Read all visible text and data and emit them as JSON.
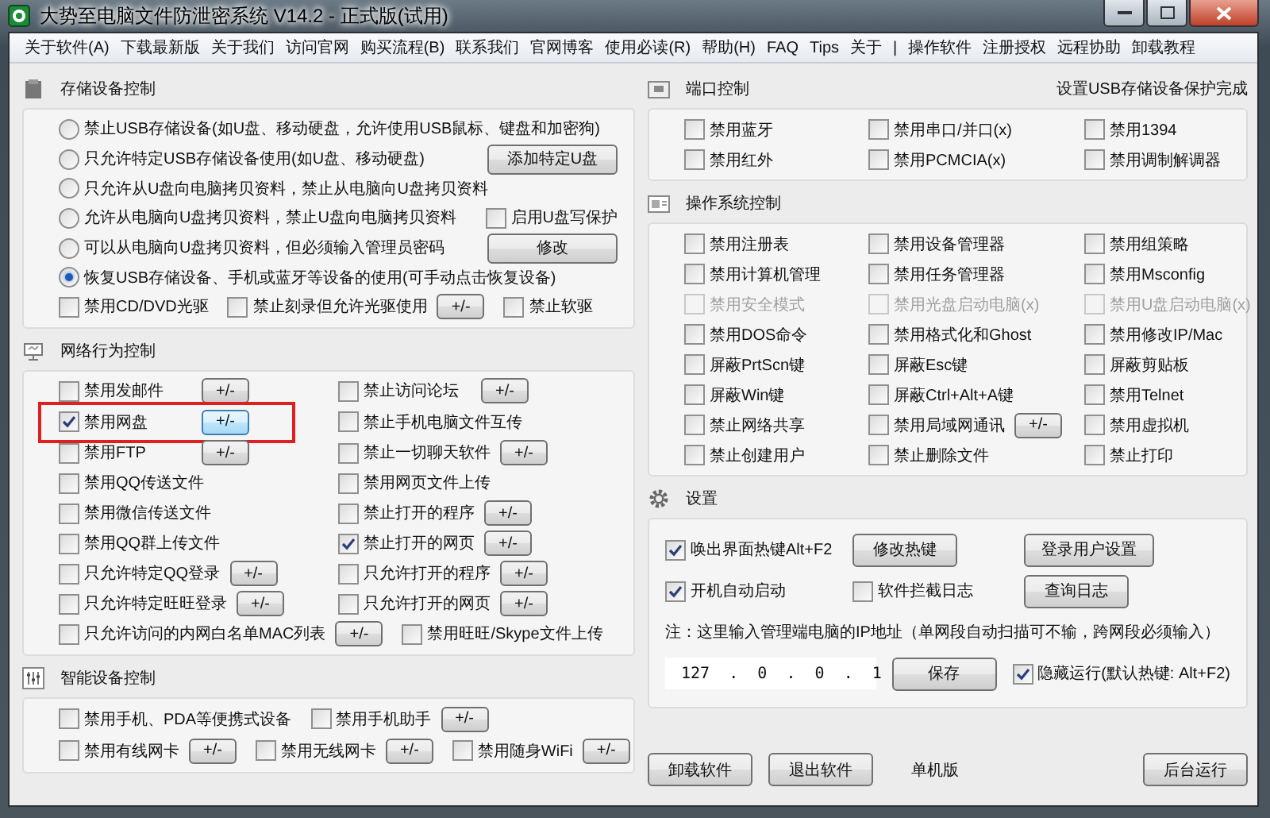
{
  "window": {
    "title": "大势至电脑文件防泄密系统 V14.2 - 正式版(试用)"
  },
  "menu": [
    {
      "label": "关于软件(A)"
    },
    {
      "label": "下载最新版"
    },
    {
      "label": "关于我们"
    },
    {
      "label": "访问官网"
    },
    {
      "label": "购买流程(B)"
    },
    {
      "label": "联系我们"
    },
    {
      "label": "官网博客"
    },
    {
      "label": "使用必读(R)"
    },
    {
      "label": "帮助(H)"
    },
    {
      "label": "FAQ"
    },
    {
      "label": "Tips"
    },
    {
      "label": "关于"
    },
    {
      "label": "|"
    },
    {
      "label": "操作软件"
    },
    {
      "label": "注册授权"
    },
    {
      "label": "远程协助"
    }
  ],
  "menu_right": {
    "label": "卸载教程"
  },
  "left_sections": [
    {
      "kind": "storage",
      "title": "存储设备控制",
      "rows": [
        {
          "kind": "line",
          "items": [
            {
              "kind": "radio",
              "label": "禁止USB存储设备(如U盘、移动硬盘，允许使用USB鼠标、键盘和加密狗)",
              "selected": false
            }
          ]
        },
        {
          "kind": "line",
          "items": [
            {
              "kind": "radio",
              "label": "只允许特定USB存储设备使用(如U盘、移动硬盘)",
              "selected": false
            },
            {
              "kind": "button",
              "label": "添加特定U盘"
            }
          ]
        },
        {
          "kind": "line",
          "items": [
            {
              "kind": "radio",
              "label": "只允许从U盘向电脑拷贝资料，禁止从电脑向U盘拷贝资料",
              "selected": false
            }
          ]
        },
        {
          "kind": "line",
          "items": [
            {
              "kind": "radio",
              "label": "允许从电脑向U盘拷贝资料，禁止U盘向电脑拷贝资料",
              "selected": false
            },
            {
              "kind": "checkbox",
              "label": "启用U盘写保护",
              "checked": false
            }
          ]
        },
        {
          "kind": "line",
          "items": [
            {
              "kind": "radio",
              "label": "可以从电脑向U盘拷贝资料，但必须输入管理员密码",
              "selected": false
            },
            {
              "kind": "button",
              "label": "修改"
            }
          ]
        },
        {
          "kind": "line",
          "items": [
            {
              "kind": "radio",
              "label": "恢复USB存储设备、手机或蓝牙等设备的使用(可手动点击恢复设备)",
              "selected": true
            }
          ]
        },
        {
          "kind": "flow",
          "items": [
            {
              "kind": "checkbox",
              "label": "禁用CD/DVD光驱",
              "checked": false
            },
            {
              "kind": "checkbox",
              "label": "禁止刻录但允许光驱使用",
              "checked": false,
              "button": "+/-"
            },
            {
              "kind": "checkbox",
              "label": "禁止软驱",
              "checked": false
            }
          ]
        }
      ]
    },
    {
      "kind": "network",
      "title": "网络行为控制",
      "rows": [
        {
          "kind": "grid",
          "items": [
            {
              "kind": "checkbox",
              "label": "禁用发邮件",
              "checked": false,
              "button": "+/-"
            },
            {
              "kind": "checkbox",
              "label": "禁止访问论坛",
              "checked": false,
              "button": "+/-"
            }
          ]
        },
        {
          "kind": "grid",
          "items": [
            {
              "kind": "checkbox",
              "label": "禁用网盘",
              "checked": true,
              "button": "+/-",
              "highlighted": true
            },
            {
              "kind": "checkbox",
              "label": "禁止手机电脑文件互传",
              "checked": false
            }
          ]
        },
        {
          "kind": "grid",
          "items": [
            {
              "kind": "checkbox",
              "label": "禁用FTP",
              "checked": false,
              "button": "+/-"
            },
            {
              "kind": "checkbox",
              "label": "禁止一切聊天软件",
              "checked": false,
              "button": "+/-"
            }
          ]
        },
        {
          "kind": "grid",
          "items": [
            {
              "kind": "checkbox",
              "label": "禁用QQ传送文件",
              "checked": false
            },
            {
              "kind": "checkbox",
              "label": "禁用网页文件上传",
              "checked": false
            }
          ]
        },
        {
          "kind": "grid",
          "items": [
            {
              "kind": "checkbox",
              "label": "禁用微信传送文件",
              "checked": false
            },
            {
              "kind": "checkbox",
              "label": "禁止打开的程序",
              "checked": false,
              "button": "+/-"
            }
          ]
        },
        {
          "kind": "grid",
          "items": [
            {
              "kind": "checkbox",
              "label": "禁用QQ群上传文件",
              "checked": false
            },
            {
              "kind": "checkbox",
              "label": "禁止打开的网页",
              "checked": true,
              "button": "+/-"
            }
          ]
        },
        {
          "kind": "grid",
          "items": [
            {
              "kind": "checkbox",
              "label": "只允许特定QQ登录",
              "checked": false,
              "button": "+/-"
            },
            {
              "kind": "checkbox",
              "label": "只允许打开的程序",
              "checked": false,
              "button": "+/-"
            }
          ]
        },
        {
          "kind": "grid",
          "items": [
            {
              "kind": "checkbox",
              "label": "只允许特定旺旺登录",
              "checked": false,
              "button": "+/-"
            },
            {
              "kind": "checkbox",
              "label": "只允许打开的网页",
              "checked": false,
              "button": "+/-"
            }
          ]
        },
        {
          "kind": "flow",
          "items": [
            {
              "kind": "checkbox",
              "label": "只允许访问的内网白名单MAC列表",
              "checked": false,
              "button": "+/-"
            },
            {
              "kind": "checkbox",
              "label": "禁用旺旺/Skype文件上传",
              "checked": false
            }
          ]
        }
      ]
    },
    {
      "kind": "smart",
      "title": "智能设备控制",
      "rows": [
        {
          "kind": "flow",
          "items": [
            {
              "kind": "checkbox",
              "label": "禁用手机、PDA等便携式设备",
              "checked": false
            },
            {
              "kind": "checkbox",
              "label": "禁用手机助手",
              "checked": false,
              "button": "+/-"
            }
          ]
        },
        {
          "kind": "flow",
          "items": [
            {
              "kind": "checkbox",
              "label": "禁用有线网卡",
              "checked": false,
              "button": "+/-"
            },
            {
              "kind": "checkbox",
              "label": "禁用无线网卡",
              "checked": false,
              "button": "+/-"
            },
            {
              "kind": "checkbox",
              "label": "禁用随身WiFi",
              "checked": false,
              "button": "+/-"
            }
          ]
        }
      ]
    }
  ],
  "right_sections": [
    {
      "kind": "port",
      "title": "端口控制",
      "status": "设置USB存储设备保护完成",
      "rows": [
        {
          "kind": "grid",
          "items": [
            {
              "kind": "checkbox",
              "label": "禁用蓝牙",
              "checked": false
            },
            {
              "kind": "checkbox",
              "label": "禁用串口/并口(x)",
              "checked": false
            },
            {
              "kind": "checkbox",
              "label": "禁用1394",
              "checked": false
            }
          ]
        },
        {
          "kind": "grid",
          "items": [
            {
              "kind": "checkbox",
              "label": "禁用红外",
              "checked": false
            },
            {
              "kind": "checkbox",
              "label": "禁用PCMCIA(x)",
              "checked": false
            },
            {
              "kind": "checkbox",
              "label": "禁用调制解调器",
              "checked": false
            }
          ]
        }
      ]
    },
    {
      "kind": "os",
      "title": "操作系统控制",
      "rows": [
        {
          "kind": "grid",
          "items": [
            {
              "kind": "checkbox",
              "label": "禁用注册表",
              "checked": false
            },
            {
              "kind": "checkbox",
              "label": "禁用设备管理器",
              "checked": false
            },
            {
              "kind": "checkbox",
              "label": "禁用组策略",
              "checked": false
            }
          ]
        },
        {
          "kind": "grid",
          "items": [
            {
              "kind": "checkbox",
              "label": "禁用计算机管理",
              "checked": false
            },
            {
              "kind": "checkbox",
              "label": "禁用任务管理器",
              "checked": false
            },
            {
              "kind": "checkbox",
              "label": "禁用Msconfig",
              "checked": false
            }
          ]
        },
        {
          "kind": "grid",
          "items": [
            {
              "kind": "checkbox",
              "label": "禁用安全模式",
              "checked": false,
              "disabled": true
            },
            {
              "kind": "checkbox",
              "label": "禁用光盘启动电脑(x)",
              "checked": false,
              "disabled": true
            },
            {
              "kind": "checkbox",
              "label": "禁用U盘启动电脑(x)",
              "checked": false,
              "disabled": true
            }
          ]
        },
        {
          "kind": "grid",
          "items": [
            {
              "kind": "checkbox",
              "label": "禁用DOS命令",
              "checked": false
            },
            {
              "kind": "checkbox",
              "label": "禁用格式化和Ghost",
              "checked": false
            },
            {
              "kind": "checkbox",
              "label": "禁用修改IP/Mac",
              "checked": false
            }
          ]
        },
        {
          "kind": "grid",
          "items": [
            {
              "kind": "checkbox",
              "label": "屏蔽PrtScn键",
              "checked": false
            },
            {
              "kind": "checkbox",
              "label": "屏蔽Esc键",
              "checked": false
            },
            {
              "kind": "checkbox",
              "label": "屏蔽剪贴板",
              "checked": false
            }
          ]
        },
        {
          "kind": "grid",
          "items": [
            {
              "kind": "checkbox",
              "label": "屏蔽Win键",
              "checked": false
            },
            {
              "kind": "checkbox",
              "label": "屏蔽Ctrl+Alt+A键",
              "checked": false
            },
            {
              "kind": "checkbox",
              "label": "禁用Telnet",
              "checked": false
            }
          ]
        },
        {
          "kind": "grid",
          "items": [
            {
              "kind": "checkbox",
              "label": "禁止网络共享",
              "checked": false
            },
            {
              "kind": "checkbox",
              "label": "禁用局域网通讯",
              "checked": false,
              "button": "+/-"
            },
            {
              "kind": "checkbox",
              "label": "禁用虚拟机",
              "checked": false
            }
          ]
        },
        {
          "kind": "grid",
          "items": [
            {
              "kind": "checkbox",
              "label": "禁止创建用户",
              "checked": false
            },
            {
              "kind": "checkbox",
              "label": "禁止删除文件",
              "checked": false
            },
            {
              "kind": "checkbox",
              "label": "禁止打印",
              "checked": false
            }
          ]
        }
      ]
    },
    {
      "kind": "settings",
      "title": "设置",
      "rows": [
        {
          "kind": "grid",
          "items": [
            {
              "kind": "checkbox",
              "label": "唤出界面热键Alt+F2",
              "checked": true
            },
            {
              "kind": "button",
              "label": "修改热键"
            },
            {
              "kind": "button",
              "label": "登录用户设置"
            }
          ]
        },
        {
          "kind": "grid",
          "items": [
            {
              "kind": "checkbox",
              "label": "开机自动启动",
              "checked": true
            },
            {
              "kind": "checkbox",
              "label": "软件拦截日志",
              "checked": false
            },
            {
              "kind": "button",
              "label": "查询日志"
            }
          ]
        },
        {
          "kind": "line",
          "items": [
            {
              "kind": "text",
              "label": "注：这里输入管理端电脑的IP地址（单网段自动扫描可不输，跨网段必须输入）"
            }
          ]
        },
        {
          "kind": "flow",
          "items": [
            {
              "kind": "field",
              "value": "127  .  0  .  0  .  1"
            },
            {
              "kind": "button",
              "label": "保存"
            },
            {
              "kind": "checkbox",
              "label": "隐藏运行(默认热键: Alt+F2)",
              "checked": true
            }
          ]
        }
      ]
    }
  ],
  "footer": [
    {
      "kind": "button",
      "label": "卸载软件"
    },
    {
      "kind": "button",
      "label": "退出软件"
    },
    {
      "kind": "text",
      "label": "单机版"
    },
    {
      "kind": "button",
      "label": "后台运行"
    }
  ]
}
